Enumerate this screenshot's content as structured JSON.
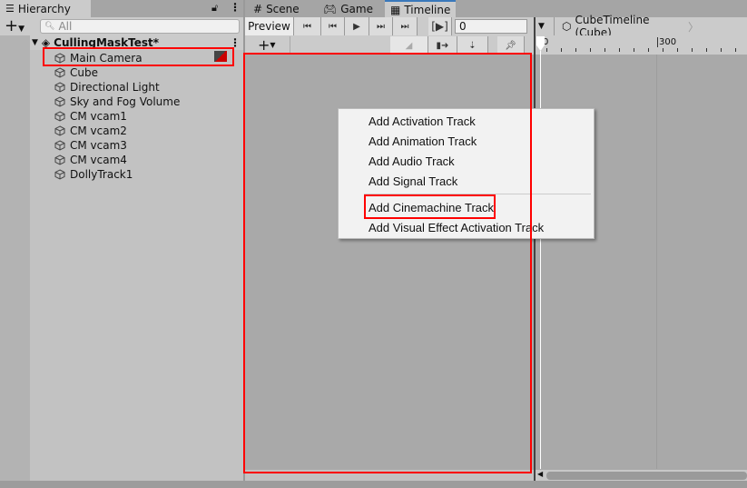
{
  "hierarchy": {
    "tab_label": "Hierarchy",
    "search_placeholder": "All",
    "scene_name": "CullingMaskTest*",
    "items": [
      "Main Camera",
      "Cube",
      "Directional Light",
      "Sky and Fog Volume",
      "CM vcam1",
      "CM vcam2",
      "CM vcam3",
      "CM vcam4",
      "DollyTrack1"
    ]
  },
  "tabs": [
    {
      "label": "Scene",
      "icon": "grid-icon"
    },
    {
      "label": "Game",
      "icon": "gamepad-icon"
    },
    {
      "label": "Timeline",
      "icon": "film-icon"
    }
  ],
  "timeline": {
    "preview_label": "Preview",
    "frame_value": "0",
    "asset_label": "CubeTimeline (Cube)",
    "ruler": [
      "0",
      "300"
    ],
    "playrange_label": "[▶]"
  },
  "menu": {
    "items": [
      "Add Activation Track",
      "Add Animation Track",
      "Add Audio Track",
      "Add Signal Track",
      "Add Cinemachine Track",
      "Add Visual Effect Activation Track"
    ]
  },
  "colors": {
    "highlight": "#ff0000",
    "accent": "#3a79bb"
  }
}
